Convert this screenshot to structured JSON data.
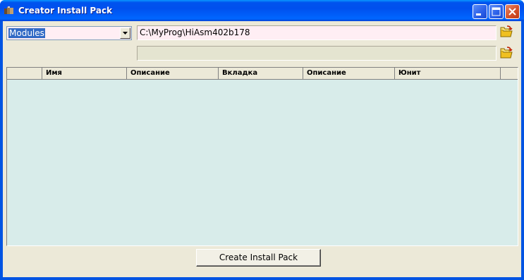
{
  "window": {
    "title": "Creator Install Pack",
    "title_icon": "app-icon",
    "controls": [
      "minimize-icon",
      "maximize-icon",
      "close-icon"
    ]
  },
  "module_combo": {
    "selected": "Modules"
  },
  "path_field": {
    "value": "C:\\MyProg\\HiAsm402b178"
  },
  "secondary_field": {
    "value": ""
  },
  "folder_buttons": [
    "open-folder-icon",
    "open-folder-icon"
  ],
  "table": {
    "columns": [
      "",
      "Имя",
      "Описание",
      "Вкладка",
      "Описание",
      "Юнит",
      ""
    ],
    "rows": []
  },
  "create_button": {
    "label": "Create Install Pack"
  },
  "colors": {
    "titlebar": "#0054e3",
    "client": "#ece9d8",
    "field_pink": "#ffeef4",
    "grid_body": "#d8ecea",
    "selection": "#316ac5"
  }
}
